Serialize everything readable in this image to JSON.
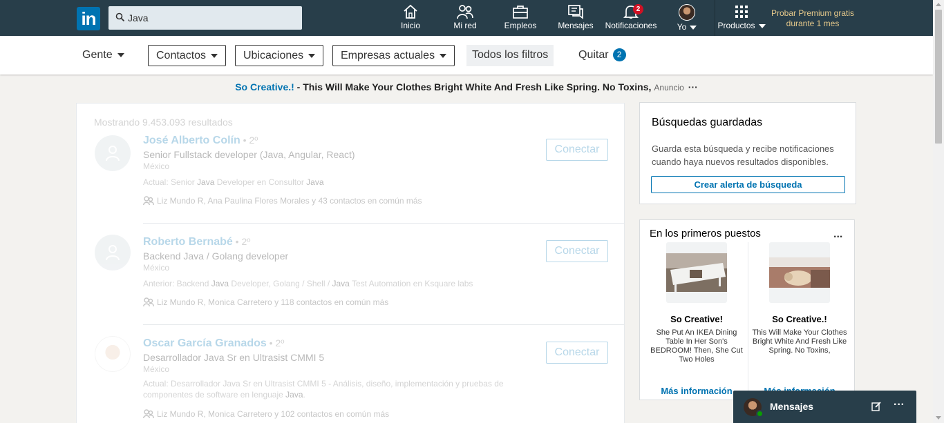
{
  "nav": {
    "logo": "in",
    "search_value": "Java",
    "items": [
      {
        "label": "Inicio"
      },
      {
        "label": "Mi red"
      },
      {
        "label": "Empleos"
      },
      {
        "label": "Mensajes"
      },
      {
        "label": "Notificaciones",
        "badge": "2"
      },
      {
        "label": "Yo"
      },
      {
        "label": "Productos"
      }
    ],
    "premium": "Probar Premium gratis durante 1 mes"
  },
  "filters": {
    "people": "Gente",
    "connections": "Contactos",
    "locations": "Ubicaciones",
    "companies": "Empresas actuales",
    "all_filters": "Todos los filtros",
    "clear": "Quitar",
    "clear_count": "2"
  },
  "ad": {
    "advertiser": "So Creative.!",
    "text": " - This Will Make Your Clothes Bright White And Fresh Like Spring. No Toxins,",
    "label": "Anuncio",
    "dots": "···"
  },
  "results": {
    "count": "Mostrando 9.453.093 resultados",
    "connect_label": "Conectar",
    "people": [
      {
        "name": "José Alberto Colín",
        "degree": " • 2º",
        "title": "Senior Fullstack developer (Java, Angular, React)",
        "location": "México",
        "snippet_pre": "Actual: Senior ",
        "snippet_kw1": "Java",
        "snippet_mid": " Developer en Consultor ",
        "snippet_kw2": "Java",
        "snippet_post": "",
        "mutual": "Liz Mundo R, Ana Paulina Flores Morales y 43 contactos en común más"
      },
      {
        "name": "Roberto Bernabé",
        "degree": " • 2º",
        "title": "Backend Java / Golang developer",
        "location": "México",
        "snippet_pre": "Anterior: Backend ",
        "snippet_kw1": "Java",
        "snippet_mid": " Developer, Golang / Shell / ",
        "snippet_kw2": "Java",
        "snippet_post": " Test Automation en Ksquare labs",
        "mutual": "Liz Mundo R, Monica Carretero y 118 contactos en común más"
      },
      {
        "name": "Oscar García Granados",
        "degree": " • 2º",
        "title": "Desarrollador Java Sr en Ultrasist CMMI 5",
        "location": "México",
        "snippet_pre": "Actual: Desarrollador Java Sr en Ultrasist CMMI 5 - Análisis, diseño, implementación y pruebas de componentes de software en lenguaje ",
        "snippet_kw1": "Java",
        "snippet_mid": ".",
        "snippet_kw2": "",
        "snippet_post": "",
        "mutual": "Liz Mundo R, Monica Carretero y 102 contactos en común más"
      }
    ]
  },
  "saved_searches": {
    "title": "Búsquedas guardadas",
    "text": "Guarda esta búsqueda y recibe notificaciones cuando haya nuevos resultados disponibles.",
    "button": "Crear alerta de búsqueda"
  },
  "promoted": {
    "title": "En los primeros puestos",
    "dots": "...",
    "cards": [
      {
        "brand": "So Creative!",
        "desc": "She Put An IKEA Dining Table In Her Son's BEDROOM! Then, She Cut Two Holes",
        "more": "Más información"
      },
      {
        "brand": "So Creative.!",
        "desc": "This Will Make Your Clothes Bright White And Fresh Like Spring. No Toxins,",
        "more": "Más información"
      }
    ]
  },
  "messaging": {
    "label": "Mensajes",
    "dots": "···"
  },
  "colors": {
    "nav_bg": "#283e4a",
    "accent": "#0073b1",
    "premium": "#e6c98b",
    "badge": "#d11124"
  }
}
